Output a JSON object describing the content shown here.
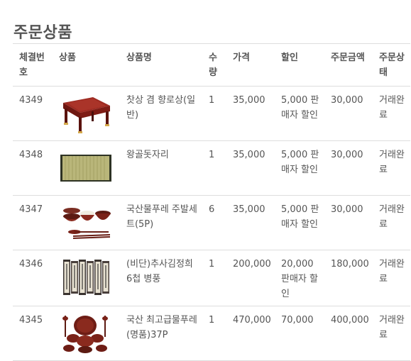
{
  "page": {
    "title": "주문상품"
  },
  "table": {
    "headers": {
      "order_no": "체결번호",
      "product": "상품",
      "product_name": "상품명",
      "quantity": "수량",
      "price": "가격",
      "discount": "할인",
      "order_amount": "주문금액",
      "status": "주문상태"
    },
    "rows": [
      {
        "order_no": "4349",
        "image": "red-lacquer-tea-table-image",
        "product_name": "찻상 겸 향로상(일반)",
        "quantity": "1",
        "price": "35,000",
        "discount": "5,000 판매자 할인",
        "order_amount": "30,000",
        "status": "거래완료"
      },
      {
        "order_no": "4348",
        "image": "woven-straw-mat-image",
        "product_name": "왕골돗자리",
        "quantity": "1",
        "price": "35,000",
        "discount": "5,000 판매자 할인",
        "order_amount": "30,000",
        "status": "거래완료"
      },
      {
        "order_no": "4347",
        "image": "lacquer-bowl-set-image",
        "product_name": "국산물푸레 주발세트(5P)",
        "quantity": "6",
        "price": "35,000",
        "discount": "5,000 판매자 할인",
        "order_amount": "30,000",
        "status": "거래완료"
      },
      {
        "order_no": "4346",
        "image": "folding-screen-image",
        "product_name": "(비단)추사김정희 6첩 병풍",
        "quantity": "1",
        "price": "200,000",
        "discount": "20,000 판매자 할인",
        "order_amount": "180,000",
        "status": "거래완료"
      },
      {
        "order_no": "4345",
        "image": "ritual-vessel-set-image",
        "product_name": "국산 최고급물푸레(명품)37P",
        "quantity": "1",
        "price": "470,000",
        "discount": "70,000",
        "order_amount": "400,000",
        "status": "거래완료"
      }
    ]
  }
}
